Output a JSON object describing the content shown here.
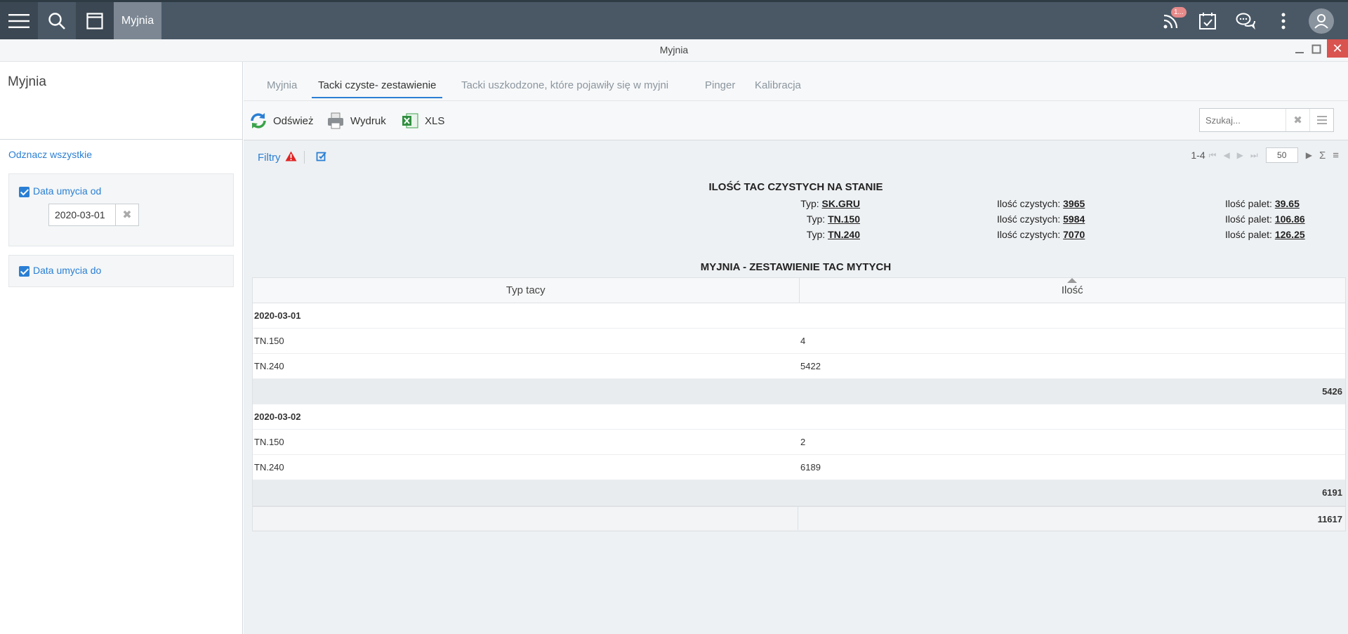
{
  "topbar": {
    "app_label": "Myjnia",
    "badge": "1..."
  },
  "window": {
    "title": "Myjnia"
  },
  "left": {
    "title": "Myjnia",
    "unselect_all": "Odznacz wszystkie",
    "filters": [
      {
        "label": "Data umycia od",
        "value": "2020-03-01"
      },
      {
        "label": "Data umycia do"
      }
    ]
  },
  "tabs": [
    "Myjnia",
    "Tacki czyste- zestawienie",
    "Tacki uszkodzone, które pojawiły się w myjni",
    "Pinger",
    "Kalibracja"
  ],
  "toolbar": {
    "refresh": "Odśwież",
    "print": "Wydruk",
    "xls": "XLS",
    "search_placeholder": "Szukaj..."
  },
  "filters_label": "Filtry",
  "pager": {
    "range": "1-4",
    "page_size": "50"
  },
  "summary": {
    "title": "ILOŚĆ TAC CZYSTYCH NA STANIE",
    "type_label": "Typ:",
    "clean_label": "Ilość czystych:",
    "pallets_label": "Ilość palet:",
    "rows": [
      {
        "type": "SK.GRU",
        "clean": "3965",
        "pallets": "39.65"
      },
      {
        "type": "TN.150",
        "clean": "5984",
        "pallets": "106.86"
      },
      {
        "type": "TN.240",
        "clean": "7070",
        "pallets": "126.25"
      }
    ]
  },
  "table": {
    "title": "MYJNIA - ZESTAWIENIE TAC MYTYCH",
    "columns": [
      "Typ tacy",
      "Ilość"
    ],
    "groups": [
      {
        "date": "2020-03-01",
        "rows": [
          {
            "type": "TN.150",
            "qty": "4"
          },
          {
            "type": "TN.240",
            "qty": "5422"
          }
        ],
        "subtotal": "5426"
      },
      {
        "date": "2020-03-02",
        "rows": [
          {
            "type": "TN.150",
            "qty": "2"
          },
          {
            "type": "TN.240",
            "qty": "6189"
          }
        ],
        "subtotal": "6191"
      }
    ],
    "total": "11617"
  }
}
